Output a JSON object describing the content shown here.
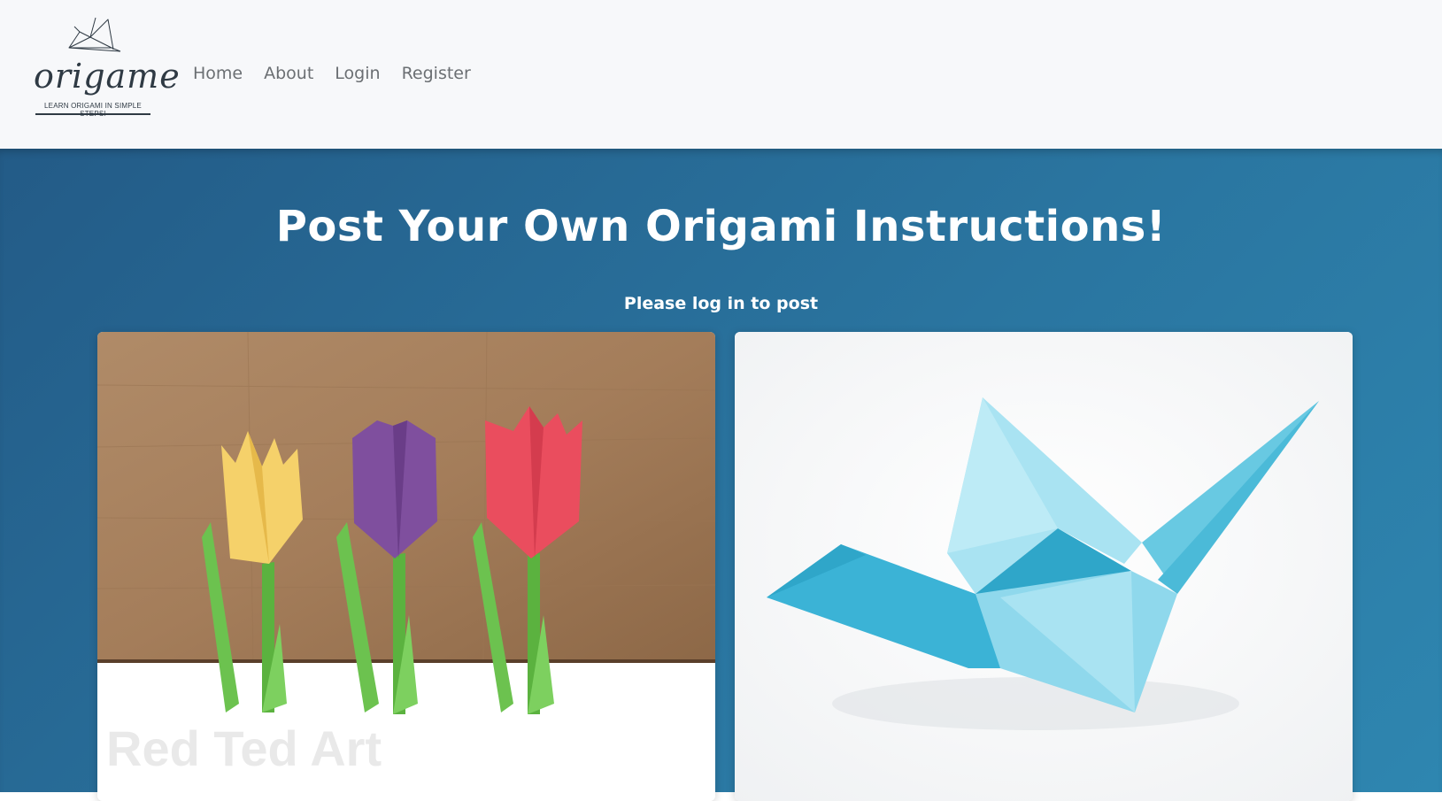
{
  "brand": {
    "wordmark": "origame",
    "tagline": "LEARN ORIGAMI IN SIMPLE STEPS!"
  },
  "nav": {
    "items": [
      "Home",
      "About",
      "Login",
      "Register"
    ]
  },
  "hero": {
    "title": "Post Your Own Origami Instructions!",
    "subtitle": "Please log in to post"
  },
  "cards": [
    {
      "image_subject": "origami-tulips",
      "watermark": "Red Ted Art",
      "colors": {
        "yellow": "#f5d16a",
        "purple": "#7f4f9e",
        "red": "#ea4d5e",
        "stem": "#6cc24f"
      }
    },
    {
      "image_subject": "origami-crane",
      "colors": {
        "crane_light": "#a9e3f2",
        "crane_mid": "#68c9e2",
        "crane_dark": "#2fa6c9"
      }
    }
  ],
  "colors": {
    "nav_bg": "#f7f8fa",
    "hero_bg_start": "#235b87",
    "hero_bg_end": "#2e86b0",
    "nav_link": "#6b6f73"
  }
}
